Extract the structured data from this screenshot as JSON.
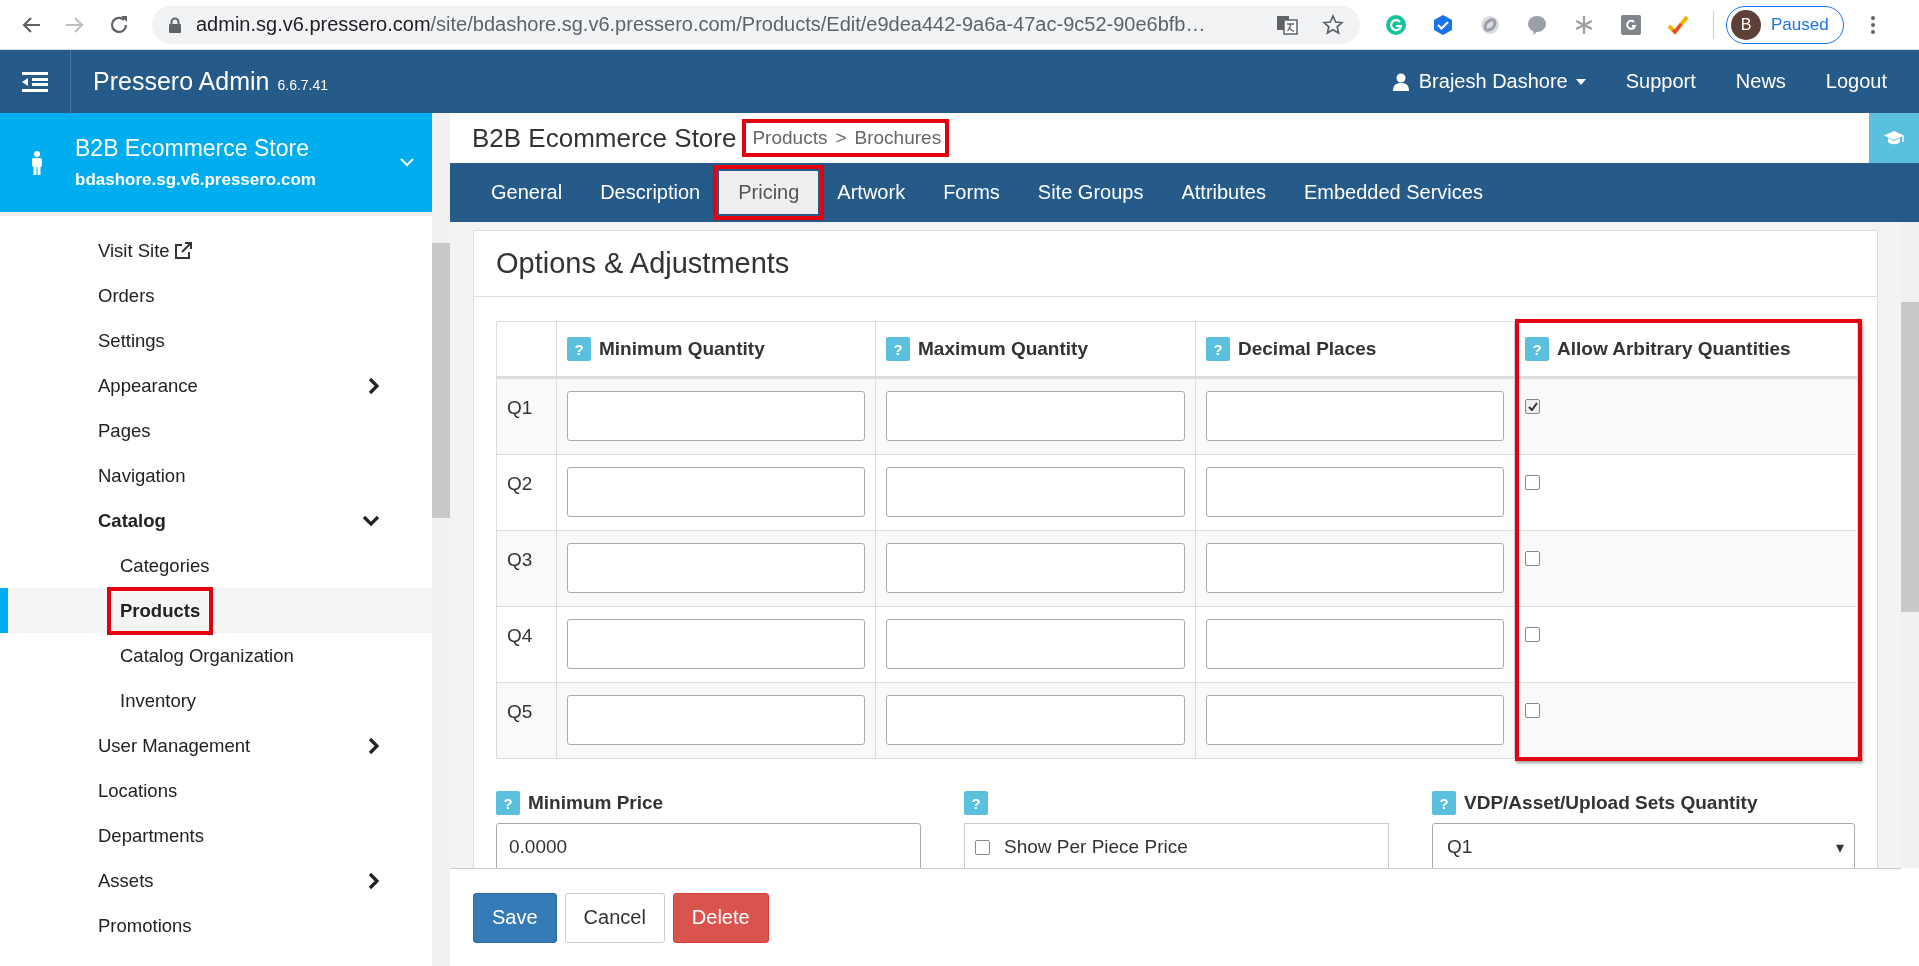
{
  "browser": {
    "url_domain": "admin.sg.v6.pressero.com",
    "url_rest": "/site/bdashore.sg.v6.pressero.com/Products/Edit/e9dea442-9a6a-47ac-9c52-90e6bfb…",
    "profile_initial": "B",
    "profile_status": "Paused"
  },
  "app_header": {
    "title": "Pressero Admin",
    "version": "6.6.7.41",
    "user": "Brajesh Dashore",
    "links": [
      "Support",
      "News",
      "Logout"
    ]
  },
  "sidebar": {
    "store_name": "B2B Ecommerce Store",
    "store_domain": "bdashore.sg.v6.pressero.com",
    "items": [
      {
        "label": "Visit Site",
        "kind": "external",
        "selected": false,
        "highlighted": false
      },
      {
        "label": "Orders",
        "kind": "link",
        "selected": false,
        "highlighted": false
      },
      {
        "label": "Settings",
        "kind": "link",
        "selected": false,
        "highlighted": false
      },
      {
        "label": "Appearance",
        "kind": "group",
        "expanded": false,
        "selected": false,
        "highlighted": false
      },
      {
        "label": "Pages",
        "kind": "link",
        "selected": false,
        "highlighted": false
      },
      {
        "label": "Navigation",
        "kind": "link",
        "selected": false,
        "highlighted": false
      },
      {
        "label": "Catalog",
        "kind": "group",
        "expanded": true,
        "selected": false,
        "highlighted": false,
        "children": [
          {
            "label": "Categories",
            "selected": false,
            "highlighted": false
          },
          {
            "label": "Products",
            "selected": true,
            "highlighted": true
          },
          {
            "label": "Catalog Organization",
            "selected": false,
            "highlighted": false
          },
          {
            "label": "Inventory",
            "selected": false,
            "highlighted": false
          }
        ]
      },
      {
        "label": "User Management",
        "kind": "group",
        "expanded": false,
        "selected": false,
        "highlighted": false
      },
      {
        "label": "Locations",
        "kind": "link",
        "selected": false,
        "highlighted": false
      },
      {
        "label": "Departments",
        "kind": "link",
        "selected": false,
        "highlighted": false
      },
      {
        "label": "Assets",
        "kind": "group",
        "expanded": false,
        "selected": false,
        "highlighted": false
      },
      {
        "label": "Promotions",
        "kind": "link",
        "selected": false,
        "highlighted": false
      }
    ]
  },
  "page": {
    "title": "B2B Ecommerce Store",
    "breadcrumb": {
      "highlighted": true,
      "items": [
        "Products",
        "Brochures"
      ],
      "separator": ">"
    }
  },
  "tabs": [
    {
      "label": "General",
      "selected": false,
      "highlighted": false
    },
    {
      "label": "Description",
      "selected": false,
      "highlighted": false
    },
    {
      "label": "Pricing",
      "selected": true,
      "highlighted": true
    },
    {
      "label": "Artwork",
      "selected": false,
      "highlighted": false
    },
    {
      "label": "Forms",
      "selected": false,
      "highlighted": false
    },
    {
      "label": "Site Groups",
      "selected": false,
      "highlighted": false
    },
    {
      "label": "Attributes",
      "selected": false,
      "highlighted": false
    },
    {
      "label": "Embedded Services",
      "selected": false,
      "highlighted": false
    }
  ],
  "section": {
    "title": "Options & Adjustments",
    "table": {
      "columns": [
        {
          "label": "Minimum Quantity",
          "help": "?",
          "highlighted": false
        },
        {
          "label": "Maximum Quantity",
          "help": "?",
          "highlighted": false
        },
        {
          "label": "Decimal Places",
          "help": "?",
          "highlighted": false
        },
        {
          "label": "Allow Arbitrary Quantities",
          "help": "?",
          "highlighted": true
        }
      ],
      "rows": [
        {
          "label": "Q1",
          "allow_arbitrary": true
        },
        {
          "label": "Q2",
          "allow_arbitrary": false
        },
        {
          "label": "Q3",
          "allow_arbitrary": false
        },
        {
          "label": "Q4",
          "allow_arbitrary": false
        },
        {
          "label": "Q5",
          "allow_arbitrary": false
        }
      ]
    },
    "fields": [
      {
        "kind": "text",
        "help": "?",
        "label": "Minimum Price",
        "value": "0.0000"
      },
      {
        "kind": "checkbox",
        "help": "?",
        "label": "Show Per Piece Price",
        "checked": false
      },
      {
        "kind": "select",
        "help": "?",
        "label": "VDP/Asset/Upload Sets Quantity",
        "value": "Q1",
        "caret": "▾"
      }
    ]
  },
  "buttons": [
    {
      "label": "Save",
      "kind": "primary"
    },
    {
      "label": "Cancel",
      "kind": "default"
    },
    {
      "label": "Delete",
      "kind": "danger"
    }
  ]
}
